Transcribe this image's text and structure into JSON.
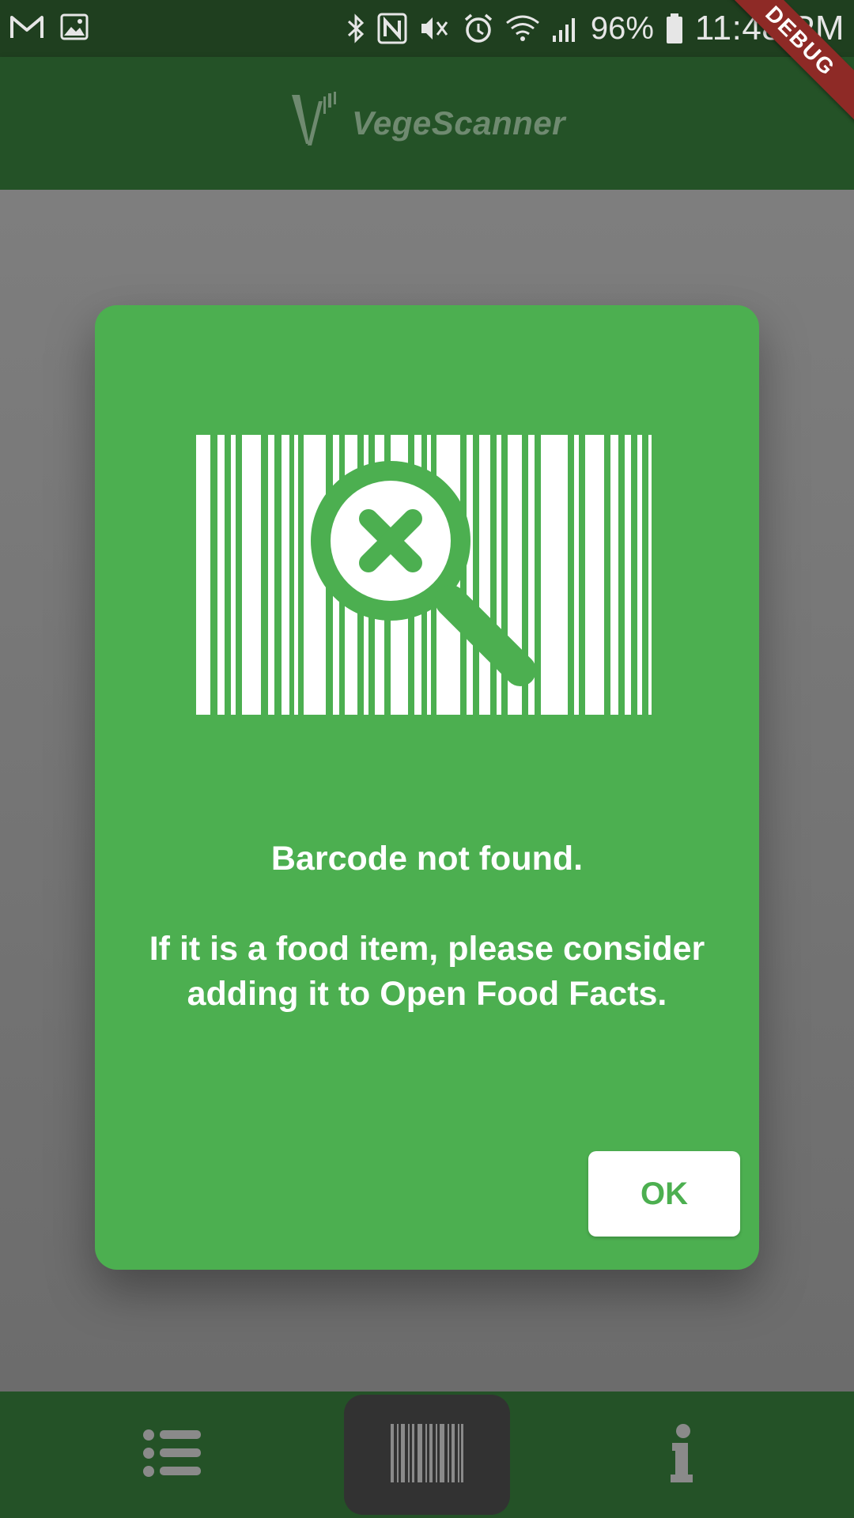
{
  "status_bar": {
    "battery": "96%",
    "time": "11:48 PM",
    "left_icons": [
      "gmail-icon",
      "image-icon"
    ],
    "right_icons": [
      "bluetooth-icon",
      "nfc-icon",
      "vibrate-icon",
      "alarm-icon",
      "wifi-icon",
      "signal-icon",
      "battery-icon"
    ]
  },
  "app_bar": {
    "title": "VegeScanner"
  },
  "debug_banner": "DEBUG",
  "dialog": {
    "message_line1": "Barcode not found.",
    "message_line2": "If it is a food item, please consider adding it to Open Food Facts.",
    "ok_label": "OK",
    "illustration_icon": "barcode-not-found-icon"
  },
  "bottom_nav": {
    "items": [
      {
        "icon": "list-icon",
        "selected": false
      },
      {
        "icon": "barcode-icon",
        "selected": true
      },
      {
        "icon": "info-icon",
        "selected": false
      }
    ]
  },
  "colors": {
    "status_bar": "#1f3f1f",
    "app_bar": "#245227",
    "dialog": "#4caf50",
    "selected_nav": "#323232",
    "debug_ribbon": "#8e2a26"
  }
}
